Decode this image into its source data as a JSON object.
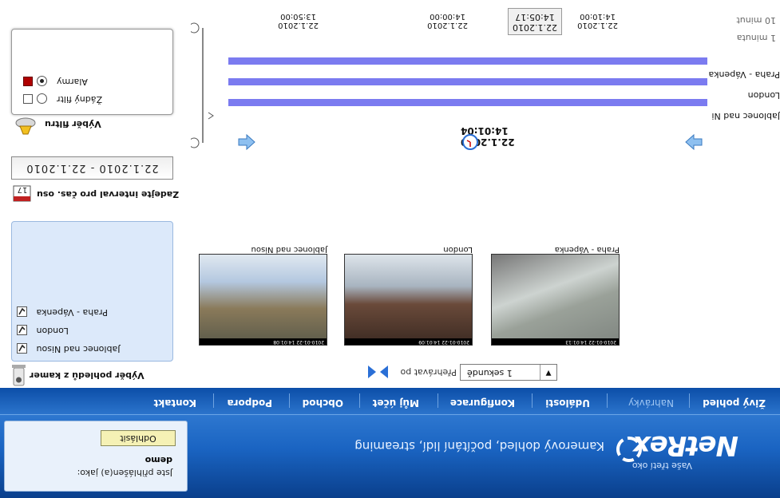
{
  "header": {
    "logo": "NetRex",
    "slogan": "Vaše třetí oko",
    "tagline": "Kamerový dohled, počítání lidí, streaming",
    "login_text": "Jste přihlášen(a) jako:",
    "login_user": "demo",
    "logout_label": "Odhlásit"
  },
  "menu": {
    "items": [
      {
        "label": "Živý pohled",
        "active": false
      },
      {
        "label": "Nahrávky",
        "active": true
      },
      {
        "label": "Události",
        "active": false
      },
      {
        "label": "Konfigurace",
        "active": false
      },
      {
        "label": "Můj účet",
        "active": false
      },
      {
        "label": "Obchod",
        "active": false
      },
      {
        "label": "Podpora",
        "active": false
      },
      {
        "label": "Kontakt",
        "active": false
      }
    ]
  },
  "camera_selector": {
    "title": "Výběr pohledů z kamer",
    "cameras": [
      "Jablonec nad Nisou",
      "London",
      "Praha - Vápenka"
    ]
  },
  "playback": {
    "speed_label": "Přehrávat po",
    "speed_value": "1 sekundě",
    "thumbnails": [
      {
        "name": "Jablonec nad Nisou",
        "timestamp": "2010-01-22 14:01:08"
      },
      {
        "name": "London",
        "timestamp": "2010-01-22 14:01:09"
      },
      {
        "name": "Praha - Vápenka",
        "timestamp": "2010-01-22 14:01:13"
      }
    ]
  },
  "interval": {
    "title": "Zadejte interval pro čas. osu",
    "date_range": "22.1.2010 - 22.1.2010"
  },
  "filter": {
    "title": "Výběr filtru",
    "options": [
      {
        "label": "Žádný filtr",
        "selected": false
      },
      {
        "label": "Alarmy",
        "selected": true
      }
    ],
    "alarm_color": "#b00000"
  },
  "timeline": {
    "current_datetime": "22.1.2010 14:01:04",
    "cursor_time": "14:05:17",
    "cursor_date": "22.1.2010",
    "ticks": [
      {
        "time": "13:50:00",
        "date": "22.1.2010"
      },
      {
        "time": "14:00:00",
        "date": "22.1.2010"
      },
      {
        "time": "14:10:00",
        "date": "22.1.2010"
      }
    ],
    "tracks": [
      "Jablonec nad Ni",
      "London",
      "Praha - Vápenka"
    ],
    "scale_major": "10 minut",
    "scale_minor": "1 minuta",
    "track_color": "#7b7bf0",
    "cursor_color": "#d40000"
  }
}
